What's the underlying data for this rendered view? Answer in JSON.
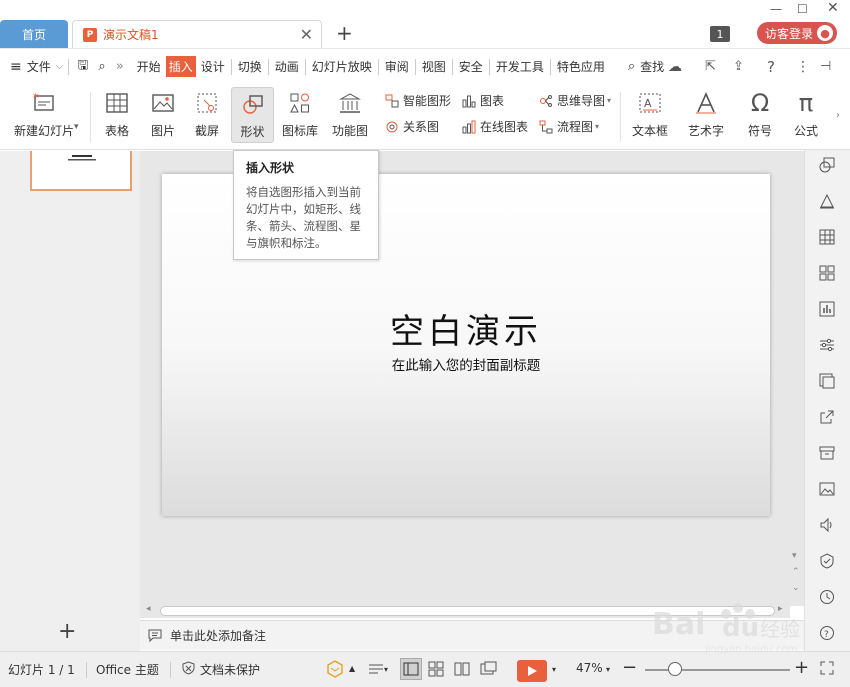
{
  "colors": {
    "accent": "#e8603c",
    "home_tab": "#5b9bd5",
    "login": "#d9534f"
  },
  "tabs": {
    "home": "首页",
    "document": "演示文稿1"
  },
  "header": {
    "badge_count": "1",
    "login_label": "访客登录"
  },
  "menu": {
    "file": "文件",
    "items": [
      "开始",
      "插入",
      "设计",
      "切换",
      "动画",
      "幻灯片放映",
      "审阅",
      "视图",
      "安全",
      "开发工具",
      "特色应用"
    ],
    "active_index": 1,
    "search": "查找"
  },
  "ribbon": {
    "new_slide": "新建幻灯片",
    "table": "表格",
    "picture": "图片",
    "screenshot": "截屏",
    "shape": "形状",
    "icon_library": "图标库",
    "function_chart": "功能图",
    "smart_art": "智能图形",
    "chart": "图表",
    "relation": "关系图",
    "online_chart": "在线图表",
    "mindmap": "思维导图",
    "flowchart": "流程图",
    "textbox": "文本框",
    "art_text": "艺术字",
    "symbol": "符号",
    "formula": "公式"
  },
  "tooltip": {
    "title": "插入形状",
    "body": "将自选图形插入到当前幻灯片中，如矩形、线条、箭头、流程图、星与旗帜和标注。"
  },
  "slide": {
    "title": "空白演示",
    "subtitle": "在此输入您的封面副标题"
  },
  "notes": {
    "placeholder": "单击此处添加备注"
  },
  "status": {
    "slide_counter": "幻灯片 1 / 1",
    "theme": "Office 主题",
    "protection": "文档未保护",
    "zoom": "47%"
  }
}
